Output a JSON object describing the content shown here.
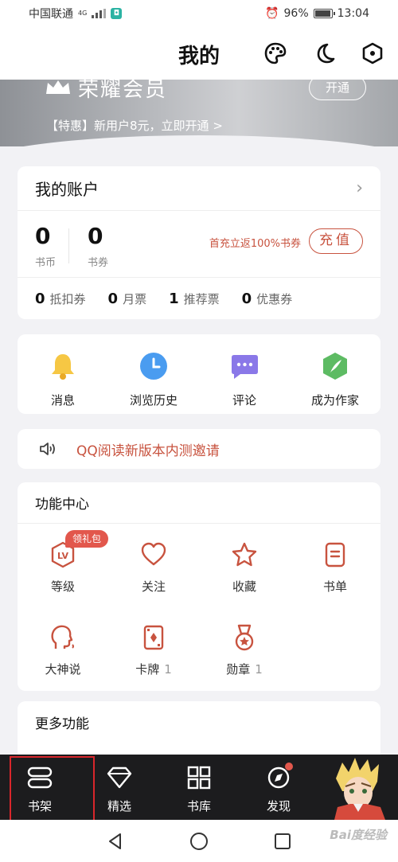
{
  "status_bar": {
    "carrier": "中国联通",
    "network": "4G",
    "battery": "96%",
    "time": "13:04"
  },
  "header": {
    "title": "我的"
  },
  "banner": {
    "vip_title": "荣耀会员",
    "subtitle": "【特惠】新用户8元，立即开通 >",
    "open_button": "开通"
  },
  "account": {
    "title": "我的账户",
    "coins": {
      "value": "0",
      "label": "书币"
    },
    "vouchers": {
      "value": "0",
      "label": "书券"
    },
    "promo": "首充立返100%书券",
    "recharge_button": "充值",
    "coupons": [
      {
        "count": "0",
        "label": "抵扣券"
      },
      {
        "count": "0",
        "label": "月票"
      },
      {
        "count": "1",
        "label": "推荐票"
      },
      {
        "count": "0",
        "label": "优惠券"
      }
    ]
  },
  "quick_actions": [
    {
      "label": "消息",
      "icon": "bell-icon"
    },
    {
      "label": "浏览历史",
      "icon": "clock-icon"
    },
    {
      "label": "评论",
      "icon": "chat-bubble-icon"
    },
    {
      "label": "成为作家",
      "icon": "feather-pen-icon"
    }
  ],
  "notice": {
    "text": "QQ阅读新版本内测邀请"
  },
  "feature_center": {
    "title": "功能中心",
    "gift_badge": "领礼包",
    "items": [
      {
        "label": "等级",
        "count": ""
      },
      {
        "label": "关注",
        "count": ""
      },
      {
        "label": "收藏",
        "count": ""
      },
      {
        "label": "书单",
        "count": ""
      },
      {
        "label": "大神说",
        "count": ""
      },
      {
        "label": "卡牌",
        "count": "1"
      },
      {
        "label": "勋章",
        "count": "1"
      }
    ]
  },
  "more": {
    "title": "更多功能"
  },
  "bottom_nav": [
    {
      "label": "书架"
    },
    {
      "label": "精选"
    },
    {
      "label": "书库"
    },
    {
      "label": "发现"
    }
  ],
  "watermark": "Bai度经验",
  "colors": {
    "accent": "#c8533f",
    "nav_bg": "#1c1c1e",
    "page_bg": "#f2f2f5"
  }
}
